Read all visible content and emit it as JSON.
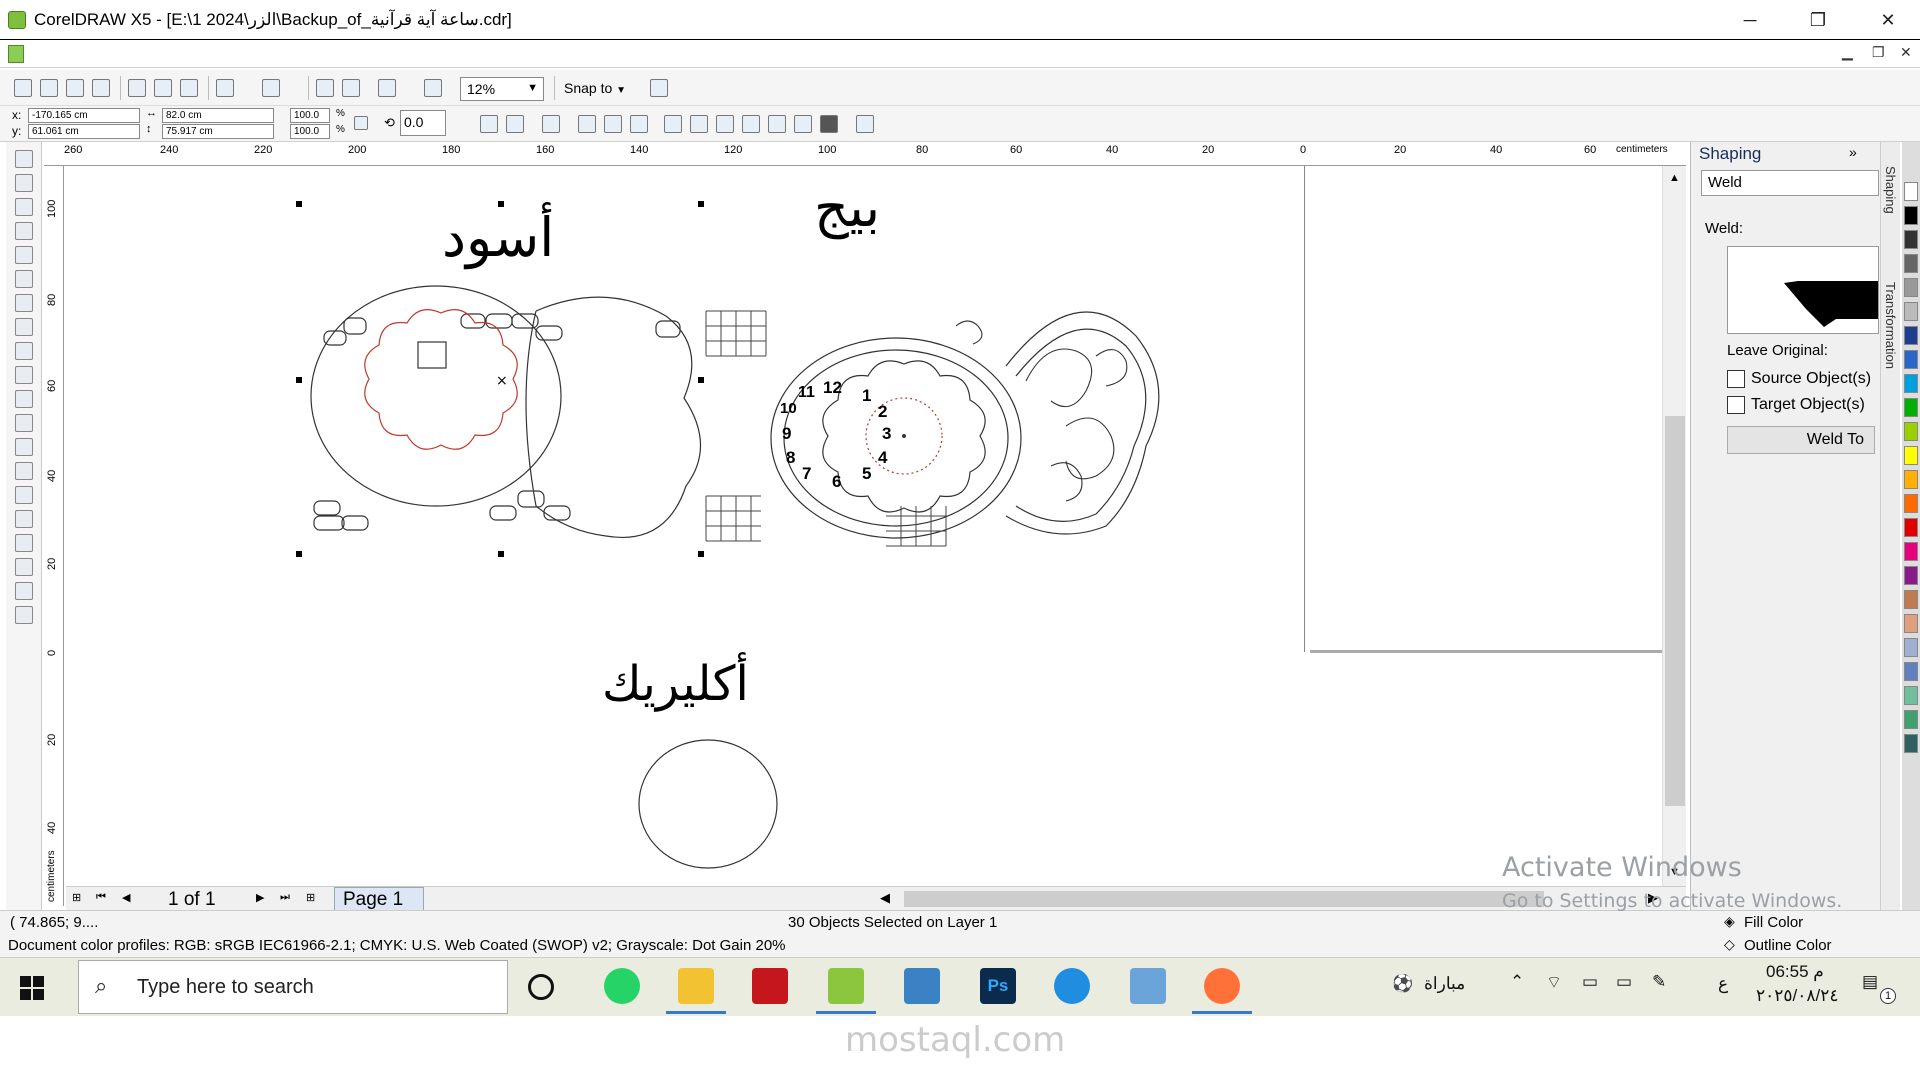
{
  "window": {
    "title": "CorelDRAW X5 - [E:\\1 2024\\الزر\\Backup_of_ساعة آية قرآنية.cdr]",
    "minimize": "─",
    "restore": "❐",
    "close": "✕",
    "mdi_minimize": "▁",
    "mdi_restore": "❐",
    "mdi_close": "✕"
  },
  "toolbar": {
    "zoom": "12%",
    "snap_to": "Snap to"
  },
  "properties": {
    "x_label": "x:",
    "y_label": "y:",
    "x": "-170.165 cm",
    "y": "61.061 cm",
    "width": "82.0 cm",
    "height": "75.917 cm",
    "scale_w": "100.0",
    "scale_h": "100.0",
    "pct": "%",
    "angle": "0.0"
  },
  "ruler": {
    "unit": "centimeters",
    "h_ticks": [
      "260",
      "240",
      "220",
      "200",
      "180",
      "160",
      "140",
      "120",
      "100",
      "80",
      "60",
      "40",
      "20",
      "0",
      "20",
      "40",
      "60"
    ],
    "v_ticks": [
      "100",
      "80",
      "60",
      "40",
      "20",
      "0",
      "20",
      "40"
    ],
    "v_unit": "centimeters"
  },
  "canvas": {
    "label_black": "أسود",
    "label_beige": "بيج",
    "label_acrylic": "أكليريك",
    "clock_numbers": [
      "12",
      "1",
      "2",
      "3",
      "4",
      "5",
      "6",
      "7",
      "8",
      "9",
      "10",
      "11"
    ]
  },
  "pagebar": {
    "count": "1 of 1",
    "page_tab": "Page 1"
  },
  "docker": {
    "title": "Shaping",
    "mode": "Weld",
    "section_label": "Weld:",
    "leave_original": "Leave Original:",
    "source_object": "Source Object(s)",
    "target_object": "Target Object(s)",
    "apply_button": "Weld To",
    "tab_shaping": "Shaping",
    "tab_transformation": "Transformation"
  },
  "palette": [
    "#ffffff",
    "#000000",
    "#333333",
    "#666666",
    "#999999",
    "#bbbbbb",
    "#1e3f8f",
    "#2a66c8",
    "#00a0e0",
    "#00b000",
    "#9bd000",
    "#ffff00",
    "#ffb000",
    "#ff6a00",
    "#e00000",
    "#e6007e",
    "#8a1a8a",
    "#c07a50",
    "#e0a080",
    "#a0b0d0",
    "#6080c0",
    "#70c0a0",
    "#40a070",
    "#306060"
  ],
  "status": {
    "coords": "( 74.865; 9....",
    "selection": "30 Objects Selected on Layer 1",
    "fill_color": "Fill Color",
    "outline_color": "Outline Color",
    "profiles": "Document color profiles: RGB: sRGB IEC61966-2.1; CMYK: U.S. Web Coated (SWOP) v2; Grayscale: Dot Gain 20%"
  },
  "watermark": {
    "line1": "Activate Windows",
    "line2": "Go to Settings to activate Windows."
  },
  "taskbar": {
    "search_placeholder": "Type here to search",
    "match_label": "مباراة",
    "ime": "ع",
    "time": "06:55 م",
    "date": "٢٠٢٥/٠٨/٢٤",
    "notifications": "1"
  },
  "site_watermark": "mostaql.com"
}
